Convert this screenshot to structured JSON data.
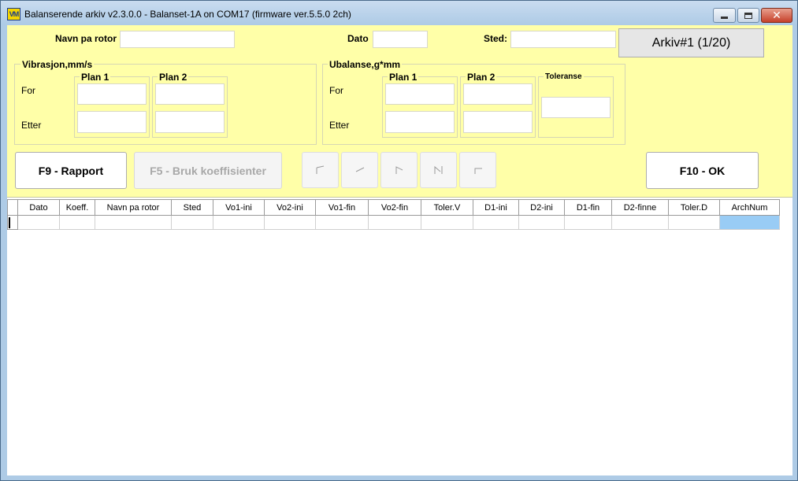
{
  "window": {
    "icon_text": "VM",
    "title": "Balanserende arkiv v2.3.0.0 - Balanset-1A on COM17 (firmware ver.5.5.0 2ch)",
    "minimize_glyph": "",
    "close_glyph": "✕"
  },
  "header": {
    "rotor_label": "Navn pa rotor",
    "rotor_value": "",
    "date_label": "Dato",
    "date_value": "",
    "place_label": "Sted:",
    "place_value": "",
    "archive_button": "Arkiv#1 (1/20)"
  },
  "vibration": {
    "title": "Vibrasjon,mm/s",
    "plan1": "Plan 1",
    "plan2": "Plan 2",
    "row_before": "For",
    "row_after": "Etter",
    "values": {
      "p1_before": "",
      "p2_before": "",
      "p1_after": "",
      "p2_after": ""
    }
  },
  "unbalance": {
    "title": "Ubalanse,g*mm",
    "plan1": "Plan 1",
    "plan2": "Plan 2",
    "tolerance": "Toleranse",
    "row_before": "For",
    "row_after": "Etter",
    "values": {
      "p1_before": "",
      "p2_before": "",
      "p1_after": "",
      "p2_after": "",
      "tolerance": ""
    }
  },
  "actions": {
    "report": "F9 - Rapport",
    "use_coeffs": "F5 - Bruk koeffisienter",
    "ok": "F10 - OK"
  },
  "table": {
    "columns": [
      "Dato",
      "Koeff.",
      "Navn pa rotor",
      "Sted",
      "Vo1-ini",
      "Vo2-ini",
      "Vo1-fin",
      "Vo2-fin",
      "Toler.V",
      "D1-ini",
      "D2-ini",
      "D1-fin",
      "D2-finne",
      "Toler.D",
      "ArchNum"
    ]
  },
  "colors": {
    "panel_bg": "#ffffa8",
    "titlebar": "#aecbe6",
    "selection": "#99ccf5"
  }
}
